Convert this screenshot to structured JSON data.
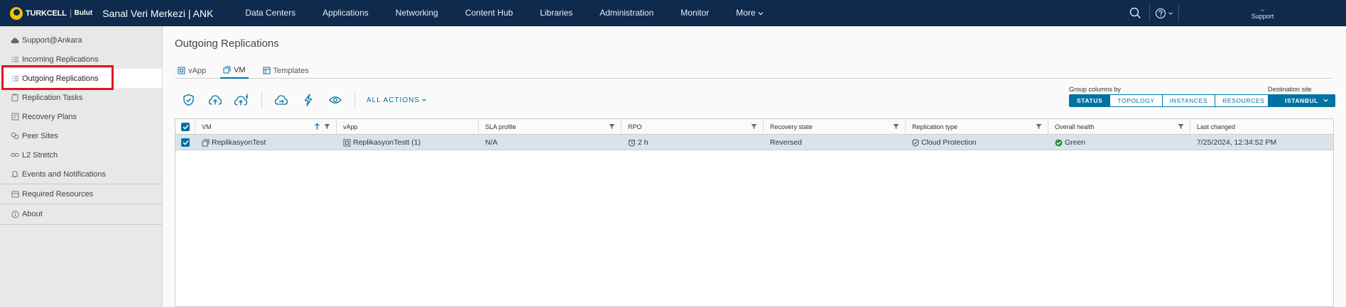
{
  "header": {
    "brand_name": "TURKCELL",
    "brand_sub": "Bulut",
    "app_title": "Sanal Veri Merkezi | ANK",
    "nav": [
      "Data Centers",
      "Applications",
      "Networking",
      "Content Hub",
      "Libraries",
      "Administration",
      "Monitor"
    ],
    "more_label": "More",
    "user_line1": "–",
    "user_line2": "Support"
  },
  "sidebar": {
    "items": [
      {
        "label": "Support@Ankara",
        "icon": "cloud-icon"
      },
      {
        "label": "Incoming Replications",
        "icon": "list-icon"
      },
      {
        "label": "Outgoing Replications",
        "icon": "list-icon"
      },
      {
        "label": "Replication Tasks",
        "icon": "clipboard-icon"
      },
      {
        "label": "Recovery Plans",
        "icon": "plan-icon"
      },
      {
        "label": "Peer Sites",
        "icon": "peer-sites-icon"
      },
      {
        "label": "L2 Stretch",
        "icon": "link-icon"
      },
      {
        "label": "Events and Notifications",
        "icon": "bell-icon"
      },
      {
        "label": "Required Resources",
        "icon": "resources-icon"
      },
      {
        "label": "About",
        "icon": "info-icon"
      }
    ]
  },
  "main": {
    "title": "Outgoing Replications",
    "tabs": [
      {
        "label": "vApp"
      },
      {
        "label": "VM"
      },
      {
        "label": "Templates"
      }
    ],
    "all_actions": "ALL ACTIONS",
    "group_columns": {
      "label": "Group columns by",
      "options": [
        "STATUS",
        "TOPOLOGY",
        "INSTANCES",
        "RESOURCES"
      ],
      "selected": "STATUS"
    },
    "destination": {
      "label": "Destination site",
      "value": "ISTANBUL"
    },
    "grid": {
      "columns": [
        "VM",
        "vApp",
        "SLA profile",
        "RPO",
        "Recovery state",
        "Replication type",
        "Overall health",
        "Last changed"
      ],
      "rows": [
        {
          "vm": "ReplikasyonTest",
          "vapp": "ReplikasyonTestt (1)",
          "sla": "N/A",
          "rpo": "2 h",
          "recovery_state": "Reversed",
          "replication_type": "Cloud Protection",
          "health": "Green",
          "last_changed": "7/25/2024, 12:34:52 PM"
        }
      ]
    }
  },
  "colors": {
    "header_bg": "#0e2a4d",
    "accent": "#0072a3",
    "highlight": "#e0141e",
    "health_green": "#2e8b3e"
  }
}
